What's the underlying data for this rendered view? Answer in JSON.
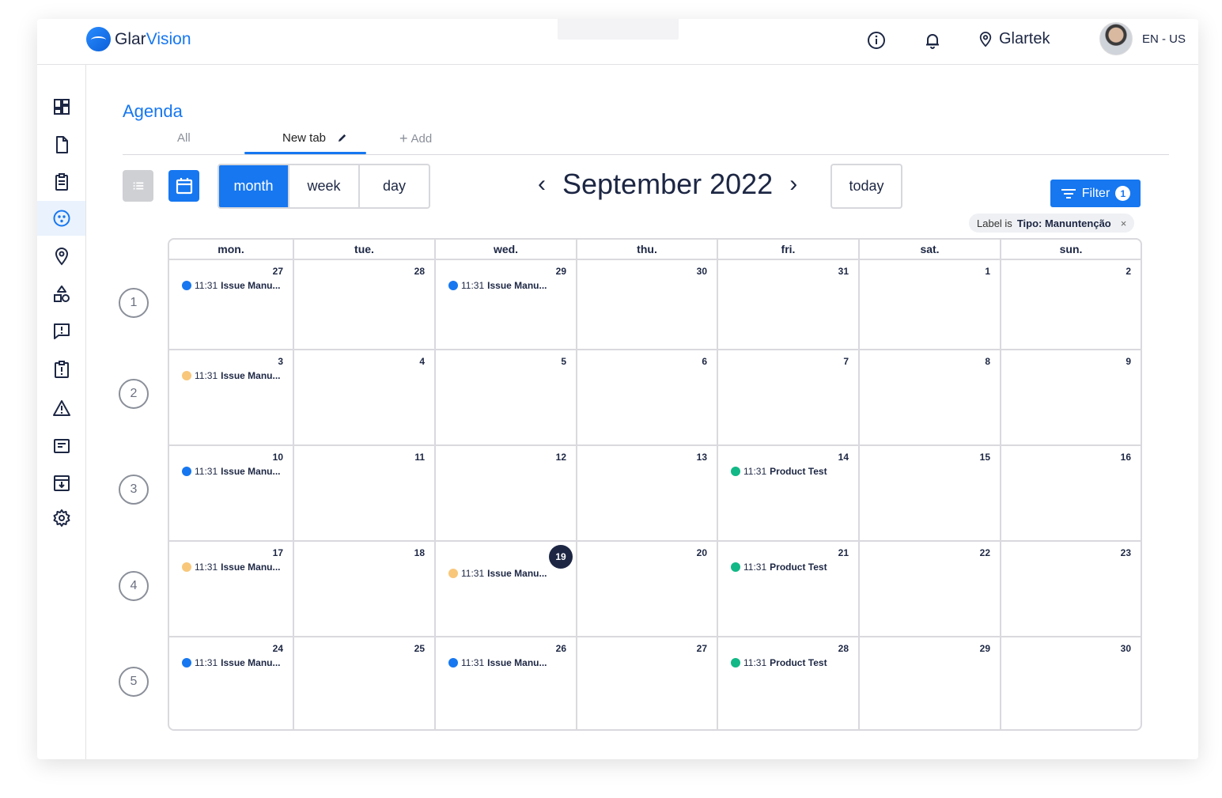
{
  "topbar": {
    "logo_part1": "Glar",
    "logo_part2": "Vision",
    "site_name": "Glartek",
    "language": "EN - US"
  },
  "sidebar": {
    "items": [
      "dashboard-icon",
      "document-icon",
      "clipboard-icon",
      "agenda-icon",
      "location-icon",
      "shapes-icon",
      "feedback-icon",
      "report-icon",
      "warning-icon",
      "card-icon",
      "archive-icon",
      "settings-icon"
    ],
    "active_item": "agenda-icon"
  },
  "page": {
    "title": "Agenda",
    "tabs": {
      "all": "All",
      "new": "New tab",
      "add": "Add"
    }
  },
  "toolbar": {
    "views": [
      "month",
      "week",
      "day"
    ],
    "active_view": "month",
    "month_label": "September 2022",
    "prev": "‹",
    "next": "›",
    "today": "today",
    "filter": "Filter",
    "filter_count": "1",
    "chip_prefix": "Label is",
    "chip_value": "Tipo: Manuntenção",
    "chip_close": "×"
  },
  "calendar": {
    "day_headers": [
      "mon.",
      "tue.",
      "wed.",
      "thu.",
      "fri.",
      "sat.",
      "sun."
    ],
    "weeks": [
      {
        "week": "1",
        "days": [
          {
            "d": "27",
            "event": {
              "time": "11:31",
              "title": "Issue Manu...",
              "color": "#1677f0"
            }
          },
          {
            "d": "28"
          },
          {
            "d": "29",
            "event": {
              "time": "11:31",
              "title": "Issue Manu...",
              "color": "#1677f0"
            }
          },
          {
            "d": "30"
          },
          {
            "d": "31"
          },
          {
            "d": "1"
          },
          {
            "d": "2"
          }
        ]
      },
      {
        "week": "2",
        "days": [
          {
            "d": "3",
            "event": {
              "time": "11:31",
              "title": "Issue Manu...",
              "color": "#f8c77a"
            }
          },
          {
            "d": "4"
          },
          {
            "d": "5"
          },
          {
            "d": "6"
          },
          {
            "d": "7"
          },
          {
            "d": "8"
          },
          {
            "d": "9"
          }
        ]
      },
      {
        "week": "3",
        "days": [
          {
            "d": "10",
            "event": {
              "time": "11:31",
              "title": "Issue Manu...",
              "color": "#1677f0"
            }
          },
          {
            "d": "11"
          },
          {
            "d": "12"
          },
          {
            "d": "13"
          },
          {
            "d": "14",
            "event": {
              "time": "11:31",
              "title": "Product Test",
              "color": "#12b886"
            }
          },
          {
            "d": "15"
          },
          {
            "d": "16"
          }
        ]
      },
      {
        "week": "4",
        "days": [
          {
            "d": "17",
            "event": {
              "time": "11:31",
              "title": "Issue Manu...",
              "color": "#f8c77a"
            }
          },
          {
            "d": "18"
          },
          {
            "d": "19",
            "today": true,
            "event": {
              "time": "11:31",
              "title": "Issue Manu...",
              "color": "#f8c77a"
            }
          },
          {
            "d": "20"
          },
          {
            "d": "21",
            "event": {
              "time": "11:31",
              "title": "Product Test",
              "color": "#12b886"
            }
          },
          {
            "d": "22"
          },
          {
            "d": "23"
          }
        ]
      },
      {
        "week": "5",
        "days": [
          {
            "d": "24",
            "event": {
              "time": "11:31",
              "title": "Issue Manu...",
              "color": "#1677f0"
            }
          },
          {
            "d": "25"
          },
          {
            "d": "26",
            "event": {
              "time": "11:31",
              "title": "Issue Manu...",
              "color": "#1677f0"
            }
          },
          {
            "d": "27"
          },
          {
            "d": "28",
            "event": {
              "time": "11:31",
              "title": "Product Test",
              "color": "#12b886"
            }
          },
          {
            "d": "29"
          },
          {
            "d": "30"
          }
        ]
      }
    ]
  },
  "colors": {
    "accent": "#1677f0",
    "navy": "#1d2744",
    "event_blue": "#1677f0",
    "event_yellow": "#f8c77a",
    "event_green": "#12b886"
  }
}
